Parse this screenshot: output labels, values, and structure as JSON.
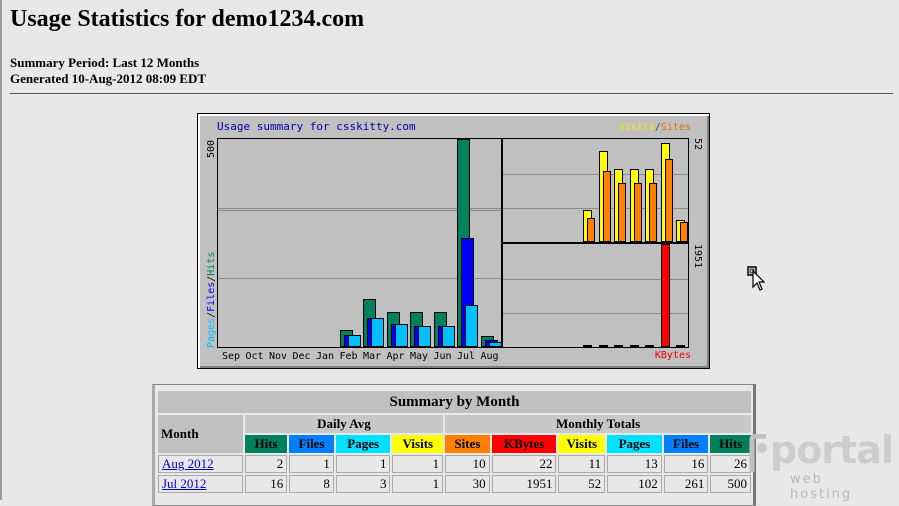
{
  "page": {
    "title": "Usage Statistics for demo1234.com",
    "summary_period": "Summary Period: Last 12 Months",
    "generated": "Generated 10-Aug-2012 08:09 EDT"
  },
  "colors": {
    "hits": "#00805c",
    "files": "#0000ff",
    "pages": "#00c0ff",
    "visits": "#ffff00",
    "sites": "#ff8000",
    "kbytes": "#ff0000"
  },
  "chart_data": {
    "type": "bar",
    "title": "Usage summary for csskitty.com",
    "categories": [
      "Sep",
      "Oct",
      "Nov",
      "Dec",
      "Jan",
      "Feb",
      "Mar",
      "Apr",
      "May",
      "Jun",
      "Jul",
      "Aug"
    ],
    "left_axis": {
      "label_parts": [
        "Pages",
        "Files",
        "Hits"
      ],
      "max_label": "500",
      "ylim": [
        0,
        500
      ]
    },
    "series": [
      {
        "name": "Hits",
        "values": [
          0,
          0,
          0,
          0,
          0,
          40,
          115,
          85,
          85,
          85,
          500,
          26
        ]
      },
      {
        "name": "Files",
        "values": [
          0,
          0,
          0,
          0,
          0,
          30,
          70,
          55,
          50,
          50,
          261,
          16
        ]
      },
      {
        "name": "Pages",
        "values": [
          0,
          0,
          0,
          0,
          0,
          30,
          70,
          55,
          50,
          50,
          102,
          13
        ]
      }
    ],
    "visits_sites": {
      "label_visits": "Visits",
      "label_sites": "Sites",
      "max_label": "52",
      "ylim": [
        0,
        52
      ],
      "visits": [
        0,
        0,
        0,
        0,
        0,
        0,
        0,
        0,
        0,
        0,
        52,
        11
      ],
      "visits_shown": [
        16,
        46,
        37,
        37,
        37,
        50,
        11
      ],
      "sites_shown": [
        12,
        36,
        30,
        30,
        30,
        42,
        10
      ]
    },
    "kbytes": {
      "label": "KBytes",
      "max_label": "1951",
      "ylim": [
        0,
        1951
      ],
      "values_shown": [
        10,
        20,
        20,
        20,
        20,
        1951,
        20
      ]
    }
  },
  "summary": {
    "caption": "Summary by Month",
    "month_header": "Month",
    "daily_avg_header": "Daily Avg",
    "monthly_totals_header": "Monthly Totals",
    "columns": [
      "Hits",
      "Files",
      "Pages",
      "Visits",
      "Sites",
      "KBytes",
      "Visits",
      "Pages",
      "Files",
      "Hits"
    ],
    "rows": [
      {
        "month": "Aug 2012",
        "values": [
          "2",
          "1",
          "1",
          "1",
          "10",
          "22",
          "11",
          "13",
          "16",
          "26"
        ]
      },
      {
        "month": "Jul 2012",
        "values": [
          "16",
          "8",
          "3",
          "1",
          "30",
          "1951",
          "52",
          "102",
          "261",
          "500"
        ]
      }
    ]
  },
  "watermark": {
    "brand": "portal",
    "sub": "web hosting"
  }
}
